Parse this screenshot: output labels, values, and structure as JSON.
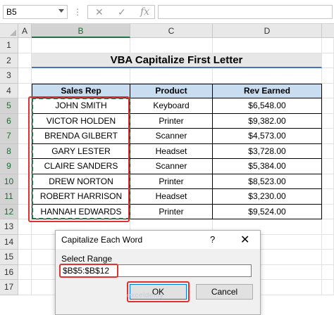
{
  "formula_bar": {
    "name_box": "B5",
    "dots": "⋮",
    "cancel_icon": "✕",
    "enter_icon": "✓",
    "fx_icon": "fx",
    "formula": ""
  },
  "columns": [
    "A",
    "B",
    "C",
    "D"
  ],
  "rows": [
    "1",
    "2",
    "3",
    "4",
    "5",
    "6",
    "7",
    "8",
    "9",
    "10",
    "11",
    "12",
    "13",
    "14",
    "15",
    "16",
    "17"
  ],
  "sheet": {
    "title": "VBA Capitalize First Letter",
    "headers": [
      "Sales Rep",
      "Product",
      "Rev Earned"
    ],
    "data": [
      [
        "JOHN SMITH",
        "Keyboard",
        "$6,548.00"
      ],
      [
        "VICTOR HOLDEN",
        "Printer",
        "$9,382.00"
      ],
      [
        "BRENDA GILBERT",
        "Scanner",
        "$4,573.00"
      ],
      [
        "GARY LESTER",
        "Headset",
        "$3,728.00"
      ],
      [
        "CLAIRE SANDERS",
        "Scanner",
        "$5,384.00"
      ],
      [
        "DREW NORTON",
        "Printer",
        "$8,523.00"
      ],
      [
        "ROBERT HARRISON",
        "Headset",
        "$3,230.00"
      ],
      [
        "HANNAH EDWARDS",
        "Printer",
        "$9,524.00"
      ]
    ]
  },
  "dialog": {
    "title": "Capitalize Each Word",
    "help": "?",
    "close": "✕",
    "label": "Select Range",
    "range_value": "$B$5:$B$12",
    "ok_label": "OK",
    "cancel_label": "Cancel"
  },
  "watermark": "exceldemy",
  "colors": {
    "header_fill": "#c9ddf0",
    "accent": "#217346",
    "highlight": "#e0302f"
  }
}
